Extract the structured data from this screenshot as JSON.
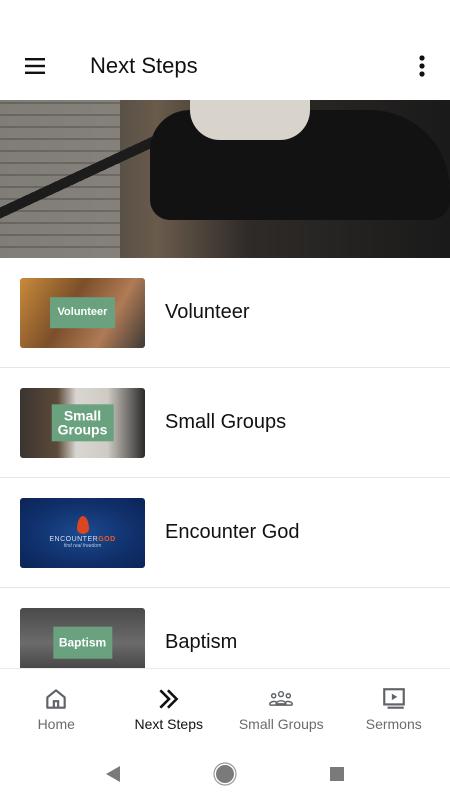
{
  "app_bar": {
    "title": "Next Steps"
  },
  "hero": {
    "image": "person-seated-on-chair-photo"
  },
  "next_steps": [
    {
      "label": "Volunteer",
      "thumb_text": "Volunteer",
      "thumb": "volunteer-photo"
    },
    {
      "label": "Small Groups",
      "thumb_text": "Small Groups",
      "thumb": "small-groups-photo"
    },
    {
      "label": "Encounter God",
      "thumb_text_a": "ENCOUNTER",
      "thumb_text_b": "GOD",
      "thumb_sub": "find real freedom",
      "thumb": "encounter-god-logo"
    },
    {
      "label": "Baptism",
      "thumb_text": "Baptism",
      "thumb": "baptism-photo"
    }
  ],
  "bottom_nav": {
    "items": [
      {
        "label": "Home",
        "icon": "home-icon",
        "active": false
      },
      {
        "label": "Next Steps",
        "icon": "double-chevron-right-icon",
        "active": true
      },
      {
        "label": "Small Groups",
        "icon": "group-icon",
        "active": false
      },
      {
        "label": "Sermons",
        "icon": "video-library-icon",
        "active": false
      }
    ]
  },
  "system_nav": {
    "buttons": [
      "back-triangle-icon",
      "home-circle-icon",
      "recents-square-icon"
    ]
  },
  "colors": {
    "accent_green": "#6aa27f",
    "active_text": "#111111",
    "inactive_text": "#6b6b6b"
  }
}
